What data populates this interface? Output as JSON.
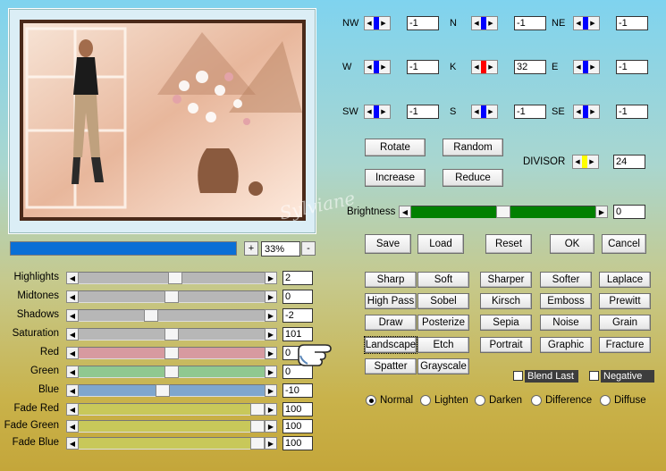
{
  "zoom": {
    "value": "33%",
    "plus": "+",
    "minus": "-",
    "progress_fraction": 1.0
  },
  "directions": [
    {
      "key": "nw",
      "label": "NW",
      "value": "-1",
      "color": "#0000ff"
    },
    {
      "key": "n",
      "label": "N",
      "value": "-1",
      "color": "#0000ff"
    },
    {
      "key": "ne",
      "label": "NE",
      "value": "-1",
      "color": "#0000ff"
    },
    {
      "key": "w",
      "label": "W",
      "value": "-1",
      "color": "#0000ff"
    },
    {
      "key": "k",
      "label": "K",
      "value": "32",
      "color": "#ff0000"
    },
    {
      "key": "e",
      "label": "E",
      "value": "-1",
      "color": "#0000ff"
    },
    {
      "key": "sw",
      "label": "SW",
      "value": "-1",
      "color": "#0000ff"
    },
    {
      "key": "s",
      "label": "S",
      "value": "-1",
      "color": "#0000ff"
    },
    {
      "key": "se",
      "label": "SE",
      "value": "-1",
      "color": "#0000ff"
    }
  ],
  "divisor": {
    "label": "DIVISOR",
    "value": "24",
    "color": "#ffff00"
  },
  "transform_buttons": {
    "rotate": "Rotate",
    "random": "Random",
    "increase": "Increase",
    "reduce": "Reduce"
  },
  "brightness": {
    "label": "Brightness",
    "value": "0",
    "level_fraction": 0.5
  },
  "actions": {
    "save": "Save",
    "load": "Load",
    "reset": "Reset",
    "ok": "OK",
    "cancel": "Cancel"
  },
  "sliders": [
    {
      "label": "Highlights",
      "value": "2",
      "level": 0.52,
      "color": "#b7b7b7"
    },
    {
      "label": "Midtones",
      "value": "0",
      "level": 0.5,
      "color": "#b7b7b7"
    },
    {
      "label": "Shadows",
      "value": "-2",
      "level": 0.38,
      "color": "#b7b7b7"
    },
    {
      "label": "Saturation",
      "value": "101",
      "level": 0.5,
      "color": "#b7b7b7"
    },
    {
      "label": "Red",
      "value": "0",
      "level": 0.5,
      "color": "#d79aa0"
    },
    {
      "label": "Green",
      "value": "0",
      "level": 0.5,
      "color": "#90c890"
    },
    {
      "label": "Blue",
      "value": "-10",
      "level": 0.45,
      "color": "#7fa6cd"
    },
    {
      "label": "Fade Red",
      "value": "100",
      "level": 1.0,
      "color": "#c8c85a"
    },
    {
      "label": "Fade Green",
      "value": "100",
      "level": 1.0,
      "color": "#c8c85a"
    },
    {
      "label": "Fade Blue",
      "value": "100",
      "level": 1.0,
      "color": "#c8c85a"
    }
  ],
  "effects": [
    [
      "Sharp",
      "Soft",
      "Sharper",
      "Softer",
      "Laplace"
    ],
    [
      "High Pass",
      "Sobel",
      "Kirsch",
      "Emboss",
      "Prewitt"
    ],
    [
      "Draw",
      "Posterize",
      "Sepia",
      "Noise",
      "Grain"
    ],
    [
      "Landscape",
      "Etch",
      "Portrait",
      "Graphic",
      "Fracture"
    ],
    [
      "Spatter",
      "Grayscale"
    ]
  ],
  "options": {
    "blend_last": "Blend Last",
    "negative": "Negative"
  },
  "blend_modes": [
    "Normal",
    "Lighten",
    "Darken",
    "Difference",
    "Diffuse"
  ],
  "selected_blend_mode": "Normal",
  "watermark": "Sylviane"
}
